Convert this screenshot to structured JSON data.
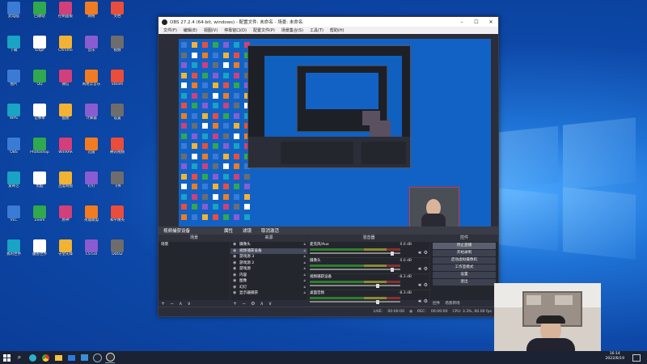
{
  "obs": {
    "title": "OBS 27.2.4 (64-bit, windows) - 配置文件: 未命名 - 场景: 未命名",
    "window_controls": [
      "–",
      "☐",
      "✕"
    ],
    "menu": [
      "文件(F)",
      "编辑(E)",
      "视图(V)",
      "停靠窗口(D)",
      "配置文件(P)",
      "场景集合(S)",
      "工具(T)",
      "帮助(H)"
    ],
    "source_toolbar": {
      "source_name": "视频捕获设备",
      "properties": "属性",
      "filters": "滤镜",
      "deactivate": "取消激活"
    },
    "docks": {
      "scenes_header": "场景",
      "sources_header": "来源",
      "mixer_header": "混音器",
      "controls_header": "控件"
    },
    "scenes": [
      "场景"
    ],
    "sources": [
      {
        "name": "摄像头",
        "selected": false
      },
      {
        "name": "视频捕获设备",
        "selected": true
      },
      {
        "name": "游戏源 3",
        "selected": false
      },
      {
        "name": "游戏源 2",
        "selected": false
      },
      {
        "name": "游戏源",
        "selected": false
      },
      {
        "name": "内容",
        "selected": false
      },
      {
        "name": "图像",
        "selected": false
      },
      {
        "name": "幻灯",
        "selected": false
      },
      {
        "name": "显示器捕获",
        "selected": false
      }
    ],
    "mixer": [
      {
        "name": "麦克风/Aux",
        "db": "0.0 dB"
      },
      {
        "name": "摄像头",
        "db": "0.0 dB"
      },
      {
        "name": "视频捕获设备",
        "db": "-8.3 dB"
      },
      {
        "name": "桌面音频",
        "db": "-8.3 dB"
      }
    ],
    "controls": [
      "停止直播",
      "开始录制",
      "启动虚拟摄像机",
      "工作室模式",
      "设置",
      "退出"
    ],
    "bottom_tabs": [
      "控件",
      "场景转场"
    ],
    "status": {
      "live_label": "LIVE:",
      "live_time": "00:00:00",
      "rec_label": "REC:",
      "rec_time": "00:00:00",
      "cpu": "CPU: 3.3%, 60.00 fps"
    }
  },
  "clock": {
    "time": "16:14",
    "date": "2022/6/19"
  },
  "desktop_icons": [
    "此电脑",
    "回收站",
    "控制面板",
    "网络",
    "文档",
    "下载",
    "Edge",
    "Chrome",
    "音乐",
    "视频",
    "图片",
    "QQ",
    "微信",
    "网易云音乐",
    "Steam",
    "WPS",
    "记事本",
    "画图",
    "计算器",
    "设置",
    "OBS",
    "Photoshop",
    "WinRAR",
    "迅雷",
    "腾讯视频",
    "爱奇艺",
    "优酷",
    "百度网盘",
    "钉钉",
    "飞书",
    "VLC",
    "Zoom",
    "原神",
    "英雄联盟",
    "和平精英",
    "我的世界",
    "魔兽世界",
    "守望先锋",
    "CS:GO",
    "Dota2"
  ],
  "colors": {
    "accent": "#1262c5",
    "obs_bg": "#2b2e38",
    "taskbar": "#1b2233"
  }
}
